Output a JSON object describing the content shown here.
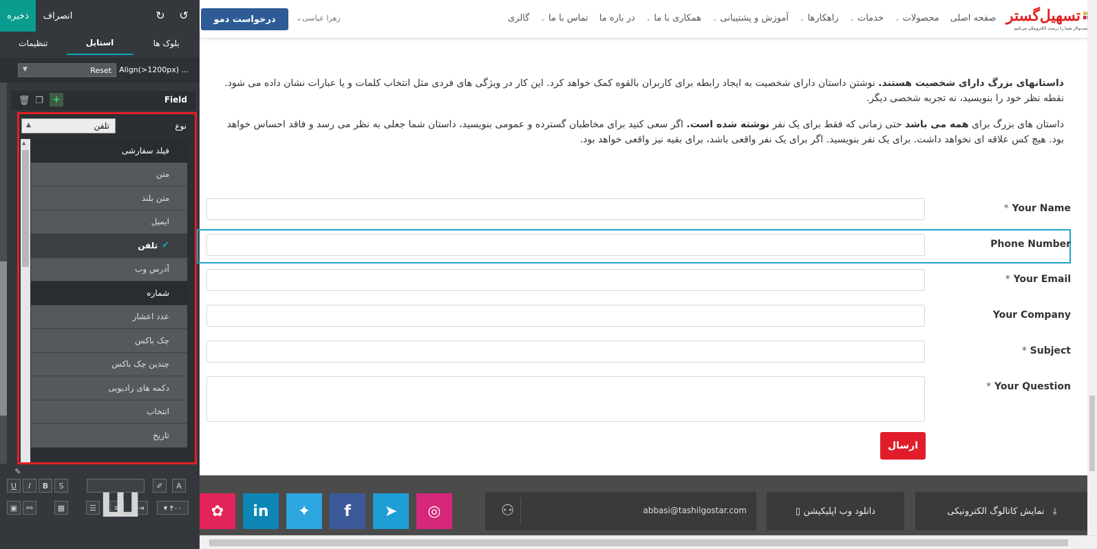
{
  "editor": {
    "save_label": "ذخیره",
    "cancel_label": "انصراف",
    "tabs": [
      {
        "label": "بلوک ها"
      },
      {
        "label": "استایل"
      },
      {
        "label": "تنظیمات"
      }
    ],
    "align_label": "Align(>1200px) ...",
    "reset_label": "Reset",
    "field_label": "Field",
    "type_label": "نوع",
    "type_value": "تلفن",
    "options": [
      {
        "label": "فیلد سفارشی",
        "style": "dark"
      },
      {
        "label": "متن",
        "style": "normal"
      },
      {
        "label": "متن بلند",
        "style": "normal"
      },
      {
        "label": "ایمیل",
        "style": "normal"
      },
      {
        "label": "تلفن",
        "style": "selected"
      },
      {
        "label": "آدرس وب",
        "style": "normal"
      },
      {
        "label": "شماره",
        "style": "dark"
      },
      {
        "label": "عدد اعشار",
        "style": "normal"
      },
      {
        "label": "چک باکس",
        "style": "normal"
      },
      {
        "label": "چندین چک باکس",
        "style": "normal"
      },
      {
        "label": "دکمه های رادیویی",
        "style": "normal"
      },
      {
        "label": "انتخاب",
        "style": "normal"
      },
      {
        "label": "تاریخ",
        "style": "normal"
      }
    ],
    "font_size": "۴۰۰"
  },
  "header": {
    "demo_button": "درخواست دمو",
    "user_name": "زهرا عباسی",
    "nav": [
      {
        "label": "صفحه اصلی",
        "dropdown": false
      },
      {
        "label": "محصولات",
        "dropdown": true
      },
      {
        "label": "خدمات",
        "dropdown": true
      },
      {
        "label": "راهکارها",
        "dropdown": true
      },
      {
        "label": "آموزش و پشتیبانی",
        "dropdown": true
      },
      {
        "label": "همکاری با ما",
        "dropdown": true
      },
      {
        "label": "در باره ما",
        "dropdown": false
      },
      {
        "label": "تماس با ما",
        "dropdown": true
      },
      {
        "label": "گالری",
        "dropdown": false
      }
    ],
    "logo_text": "تسهیل‌گستر",
    "logo_sub": "کسب‌وکار شما را درست الکترونیکی می‌کنیم"
  },
  "content": {
    "para1_bold": "داستانهای بزرگ دارای شخصیت هستند.",
    "para1_rest": " نوشتن داستان دارای شخصیت به ایجاد رابطه برای کاربران بالقوه کمک خواهد کرد. این کار در ویژگی های فردی مثل انتخاب کلمات و یا عبارات نشان داده می شود. نقطه نظر خود را بنویسید، نه تجربه شخصی دیگر.",
    "para2_a": "داستان های بزرگ برای ",
    "para2_b": "همه می باشد",
    "para2_c": " حتی زمانی که فقط برای یک نفر ",
    "para2_d": "نوشته شده است.",
    "para2_e": " اگر سعی کنید برای مخاطبان گسترده و عمومی بنویسید، داستان شما جعلی به نظر می رسد و فاقد احساس خواهد بود. هیچ کس علاقه ای نخواهد داشت. برای یک نفر بنویسید. اگر برای یک نفر واقعی باشد، برای بقیه نیز واقعی خواهد بود."
  },
  "form": {
    "fields": [
      {
        "label": "Your Name",
        "required": true
      },
      {
        "label": "Phone Number",
        "required": false
      },
      {
        "label": "Your Email",
        "required": true
      },
      {
        "label": "Your Company",
        "required": false
      },
      {
        "label": "Subject",
        "required": true
      }
    ],
    "question_label": "Your Question",
    "required_mark": "*",
    "submit_label": "ارسال"
  },
  "footer": {
    "catalog_label": "نمایش کاتالوگ الکترونیکی",
    "app_label": "دانلود وب اپلیکیشن",
    "email": "abbasi@tashilgostar.com",
    "social": [
      {
        "name": "instagram-icon",
        "color": "#d6287a",
        "glyph": "◎"
      },
      {
        "name": "telegram-icon",
        "color": "#1f9ed6",
        "glyph": "➤"
      },
      {
        "name": "facebook-icon",
        "color": "#3b5998",
        "glyph": "f"
      },
      {
        "name": "twitter-icon",
        "color": "#2ba6de",
        "glyph": "✦"
      },
      {
        "name": "linkedin-icon",
        "color": "#0b86b5",
        "glyph": "in"
      },
      {
        "name": "aparat-icon",
        "color": "#e3245a",
        "glyph": "✿"
      }
    ]
  },
  "colors": {
    "accent": "#0a9c8c",
    "demo_button": "#2c5b96",
    "submit": "#e11d2b",
    "highlight": "#1ca5c8",
    "select_box_border": "#e41e26"
  }
}
